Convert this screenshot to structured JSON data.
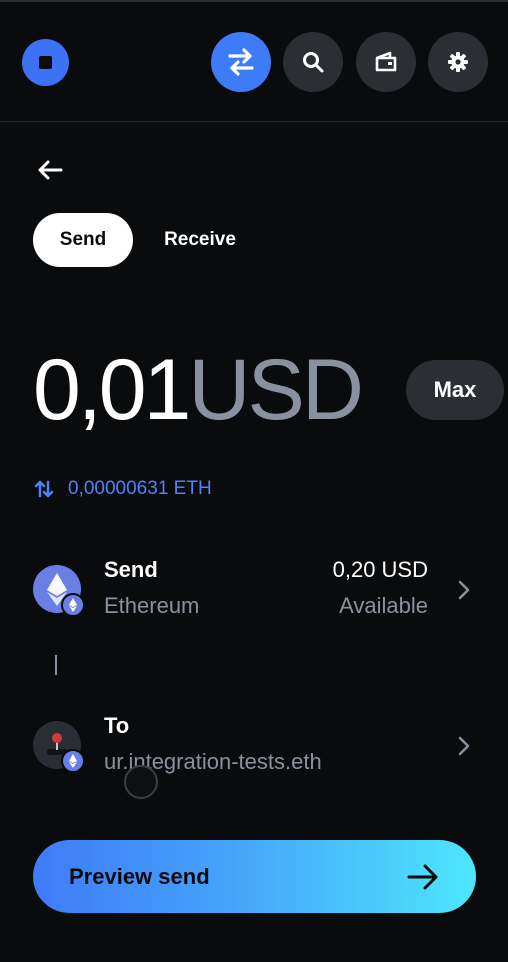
{
  "header": {
    "buttons": [
      "swap-icon",
      "search-icon",
      "wallet-icon",
      "gear-icon"
    ]
  },
  "tabs": {
    "send": "Send",
    "receive": "Receive"
  },
  "amount": {
    "value": "0,01",
    "currency": "USD"
  },
  "max_label": "Max",
  "conversion": "0,00000631 ETH",
  "send_row": {
    "title": "Send",
    "asset": "Ethereum",
    "balance": "0,20 USD",
    "balance_label": "Available"
  },
  "to_row": {
    "title": "To",
    "recipient": "ur.integration-tests.eth"
  },
  "preview_label": "Preview send",
  "colors": {
    "accent": "#3e7bf7",
    "background": "#0a0b0d",
    "muted": "#8a919e"
  }
}
